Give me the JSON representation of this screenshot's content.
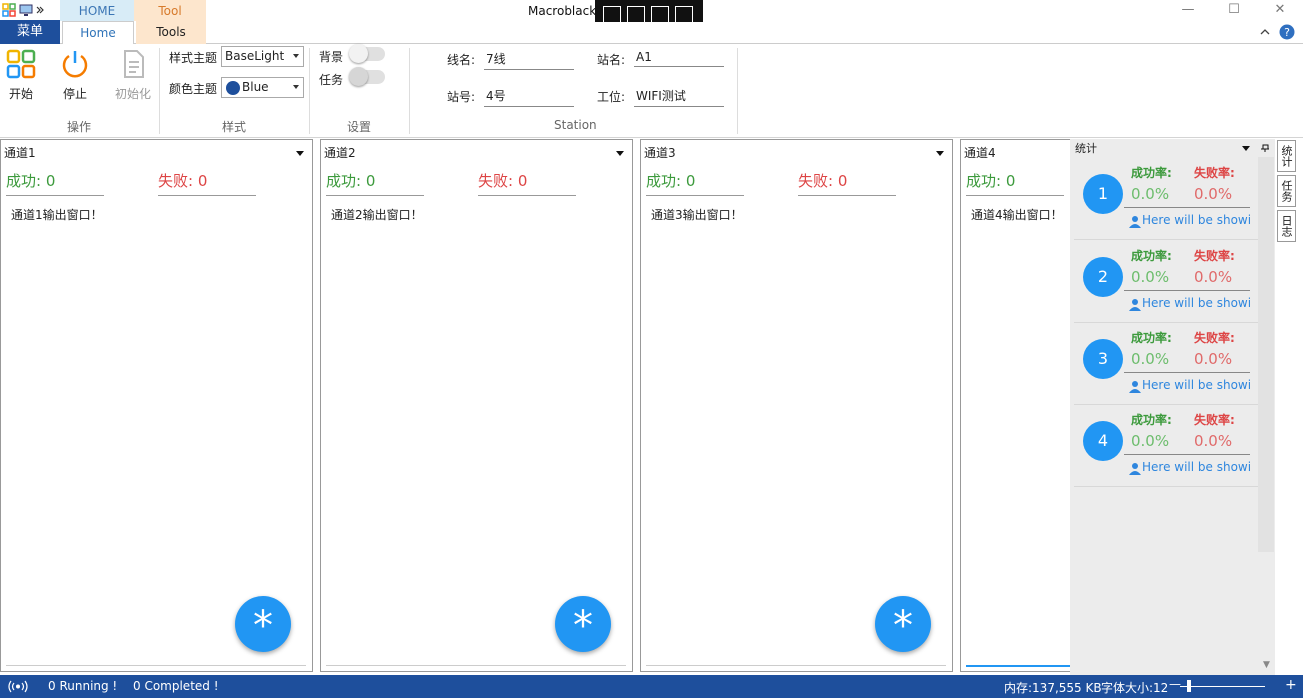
{
  "window": {
    "title": "Macroblack-V",
    "minimize": "—",
    "maximize": "☐",
    "close": "✕"
  },
  "tabs": {
    "menu": "菜单",
    "ctx_home": "HOME",
    "ctx_tool": "Tool",
    "home": "Home",
    "tools": "Tools"
  },
  "ribbon": {
    "ops": {
      "start": "开始",
      "stop": "停止",
      "init": "初始化",
      "group": "操作"
    },
    "style": {
      "theme_label": "样式主题",
      "theme_value": "BaseLight",
      "color_label": "颜色主题",
      "color_value": "Blue",
      "group": "样式"
    },
    "settings": {
      "bg_label": "背景",
      "task_label": "任务",
      "group": "设置"
    },
    "station": {
      "line_label": "线名:",
      "line_value": "7线",
      "site_label": "站名:",
      "site_value": "A1",
      "num_label": "站号:",
      "num_value": "4号",
      "work_label": "工位:",
      "work_value": "WIFI测试",
      "group": "Station"
    }
  },
  "channels": [
    {
      "title": "通道1",
      "success": "成功: 0",
      "fail": "失败: 0",
      "output": "通道1输出窗口！"
    },
    {
      "title": "通道2",
      "success": "成功: 0",
      "fail": "失败: 0",
      "output": "通道2输出窗口！"
    },
    {
      "title": "通道3",
      "success": "成功: 0",
      "fail": "失败: 0",
      "output": "通道3输出窗口！"
    },
    {
      "title": "通道4",
      "success": "成功: 0",
      "fail": "",
      "output": "通道4输出窗口！"
    }
  ],
  "fab_label": "*",
  "stats": {
    "title": "统计",
    "items": [
      {
        "num": "1",
        "s_label": "成功率:",
        "f_label": "失败率:",
        "s_value": "0.0%",
        "f_value": "0.0%",
        "hint": "Here will be showing"
      },
      {
        "num": "2",
        "s_label": "成功率:",
        "f_label": "失败率:",
        "s_value": "0.0%",
        "f_value": "0.0%",
        "hint": "Here will be showing"
      },
      {
        "num": "3",
        "s_label": "成功率:",
        "f_label": "失败率:",
        "s_value": "0.0%",
        "f_value": "0.0%",
        "hint": "Here will be showing"
      },
      {
        "num": "4",
        "s_label": "成功率:",
        "f_label": "失败率:",
        "s_value": "0.0%",
        "f_value": "0.0%",
        "hint": "Here will be showing"
      }
    ]
  },
  "side_tabs": [
    "统计",
    "任务",
    "日志"
  ],
  "status": {
    "running": "0 Running !",
    "completed": "0 Completed !",
    "memory": "内存:137,555 KB",
    "font_size": "字体大小:12",
    "minus": "—",
    "plus": "+"
  },
  "colors": {
    "accent": "#1e4f9c",
    "fab": "#2196f3",
    "success": "#3c9a3c",
    "fail": "#dd4444"
  }
}
